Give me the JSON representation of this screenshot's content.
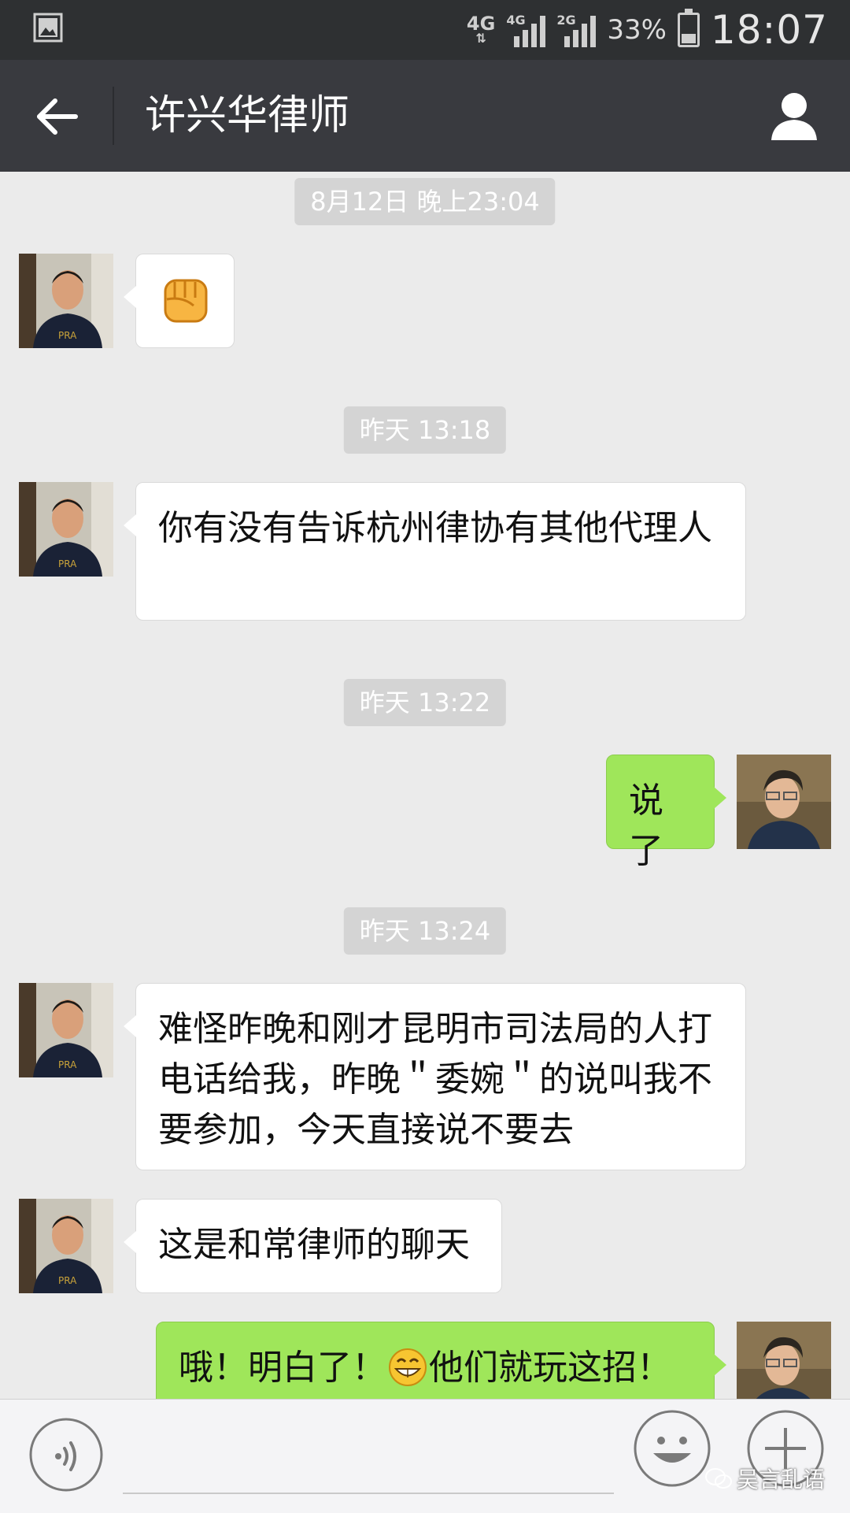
{
  "status_bar": {
    "network_type": "4G",
    "signal_1_tag": "4G",
    "signal_2_tag": "2G",
    "battery_percent": "33%",
    "time": "18:07"
  },
  "header": {
    "title": "许兴华律师",
    "back_icon": "arrow-left-icon",
    "profile_icon": "person-icon"
  },
  "messages": {
    "ts1": "8月12日 晚上23:04",
    "m1_emoji": "fist-emoji",
    "ts2": "昨天 13:18",
    "m2": "你有没有告诉杭州律协有其他代理人",
    "ts3": "昨天 13:22",
    "m3": "说了",
    "ts4": "昨天 13:24",
    "m4": "难怪昨晚和刚才昆明市司法局的人打电话给我，昨晚＂委婉＂的说叫我不要参加，今天直接说不要去",
    "m5": "这是和常律师的聊天",
    "m6_part1": "哦！明白了！",
    "m6_emoji": "grinning-emoji",
    "m6_part2": "他们就玩这招！"
  },
  "input_bar": {
    "voice_icon": "voice-icon",
    "emoji_icon": "emoji-face-icon",
    "plus_icon": "plus-icon",
    "watermark": "吴言乱语"
  },
  "colors": {
    "statusbar_bg": "#2e3032",
    "titlebar_bg": "#393a3f",
    "chat_bg": "#ebebeb",
    "bubble_in": "#ffffff",
    "bubble_out": "#9fe65a",
    "timestamp_bg": "#d4d4d4"
  }
}
